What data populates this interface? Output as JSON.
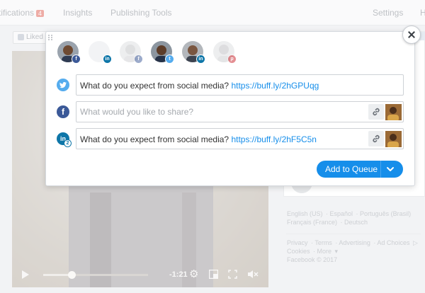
{
  "facebook": {
    "nav": {
      "notifications_label": "tifications",
      "notifications_count": "4",
      "insights_label": "Insights",
      "publishing_tools_label": "Publishing Tools",
      "settings_label": "Settings",
      "help_label": "H"
    },
    "liked_label": "Liked",
    "video": {
      "time": "-1:21",
      "progress": 0.27
    },
    "footer": {
      "languages_line1": [
        "English (US)",
        "Español",
        "Português (Brasil)"
      ],
      "languages_line2": [
        "Français (France)",
        "Deutsch"
      ],
      "links_line1": [
        "Privacy",
        "Terms",
        "Advertising",
        "Ad Choices"
      ],
      "links_line2": [
        "Cookies",
        "More"
      ],
      "copyright": "Facebook © 2017"
    }
  },
  "buffer": {
    "profiles": [
      {
        "network": "facebook",
        "badge": "f",
        "active": true
      },
      {
        "network": "linkedin",
        "badge": "in",
        "active": false
      },
      {
        "network": "facebook",
        "badge": "f",
        "active": false
      },
      {
        "network": "twitter",
        "badge": "t",
        "active": true
      },
      {
        "network": "linkedin",
        "badge": "in",
        "active": true
      },
      {
        "network": "pinterest",
        "badge": "p",
        "active": false
      }
    ],
    "composers": {
      "twitter": {
        "text": "What do you expect from social media? ",
        "link": "https://buff.ly/2hGPUqg"
      },
      "facebook": {
        "placeholder": "What would you like to share?"
      },
      "linkedin": {
        "text": "What do you expect from social media? ",
        "link": "https://buff.ly/2hF5C5n",
        "account_count": "2"
      }
    },
    "add_to_queue_label": "Add to Queue"
  },
  "colors": {
    "buffer_blue": "#168eea",
    "twitter": "#55acee",
    "facebook": "#3b5998",
    "linkedin": "#0e76a8"
  }
}
